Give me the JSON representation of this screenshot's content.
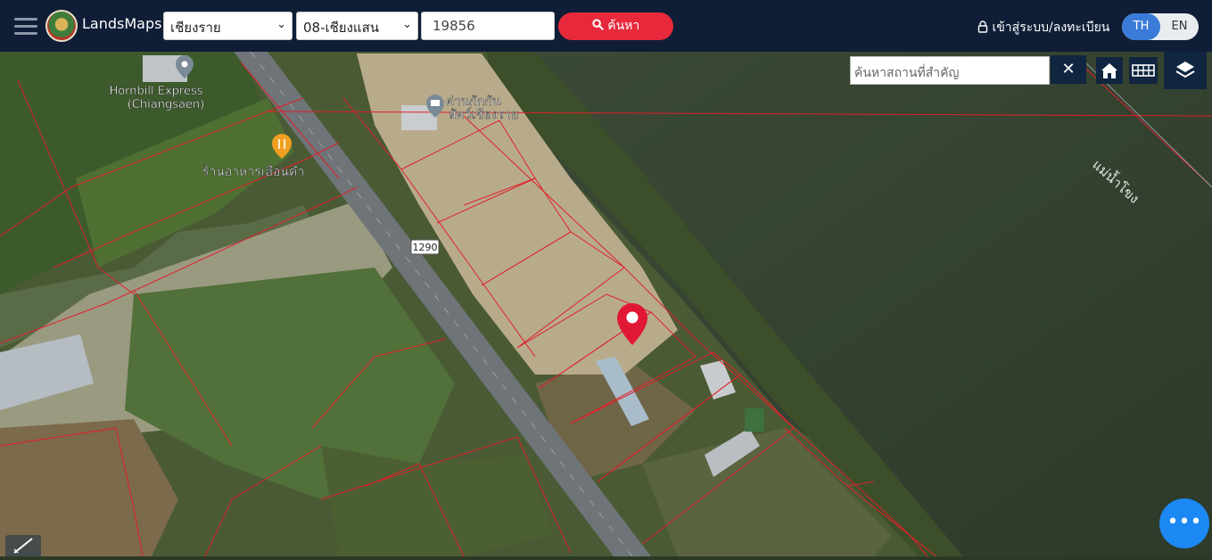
{
  "header": {
    "brand": "LandsMaps",
    "province": "เชียงราย",
    "district": "08-เชียงแสน",
    "parcel_no": "19856",
    "search_label": "ค้นหา",
    "login_label": "เข้าสู่ระบบ/ลงทะเบียน",
    "lang_th": "TH",
    "lang_en": "EN"
  },
  "map": {
    "place_search_placeholder": "ค้นหาสถานที่สำคัญ",
    "road_shield": "1290",
    "river_label": "แม่น้ำโขง",
    "poi": [
      {
        "name_line1": "Hornbill Express",
        "name_line2": "(Chiangsaen)"
      },
      {
        "name_line1": "ด่านกักกัน",
        "name_line2": "สัตว์เชียงราย"
      },
      {
        "name_line1": "ร้านอาหารเฮือนคำ"
      }
    ]
  },
  "icons": {
    "menu": "hamburger-icon",
    "search": "search-icon",
    "lock": "lock-icon",
    "close": "close-icon",
    "home": "home-icon",
    "grid": "grid-icon",
    "layers": "layers-icon",
    "more": "more-icon",
    "pin": "map-pin-icon",
    "measure": "ruler-icon"
  },
  "colors": {
    "header_bg": "#0f1e36",
    "search_button": "#e8293c",
    "lang_active": "#3b7bd8",
    "parcel_lines": "#e0202a",
    "fab": "#1b88f3"
  }
}
